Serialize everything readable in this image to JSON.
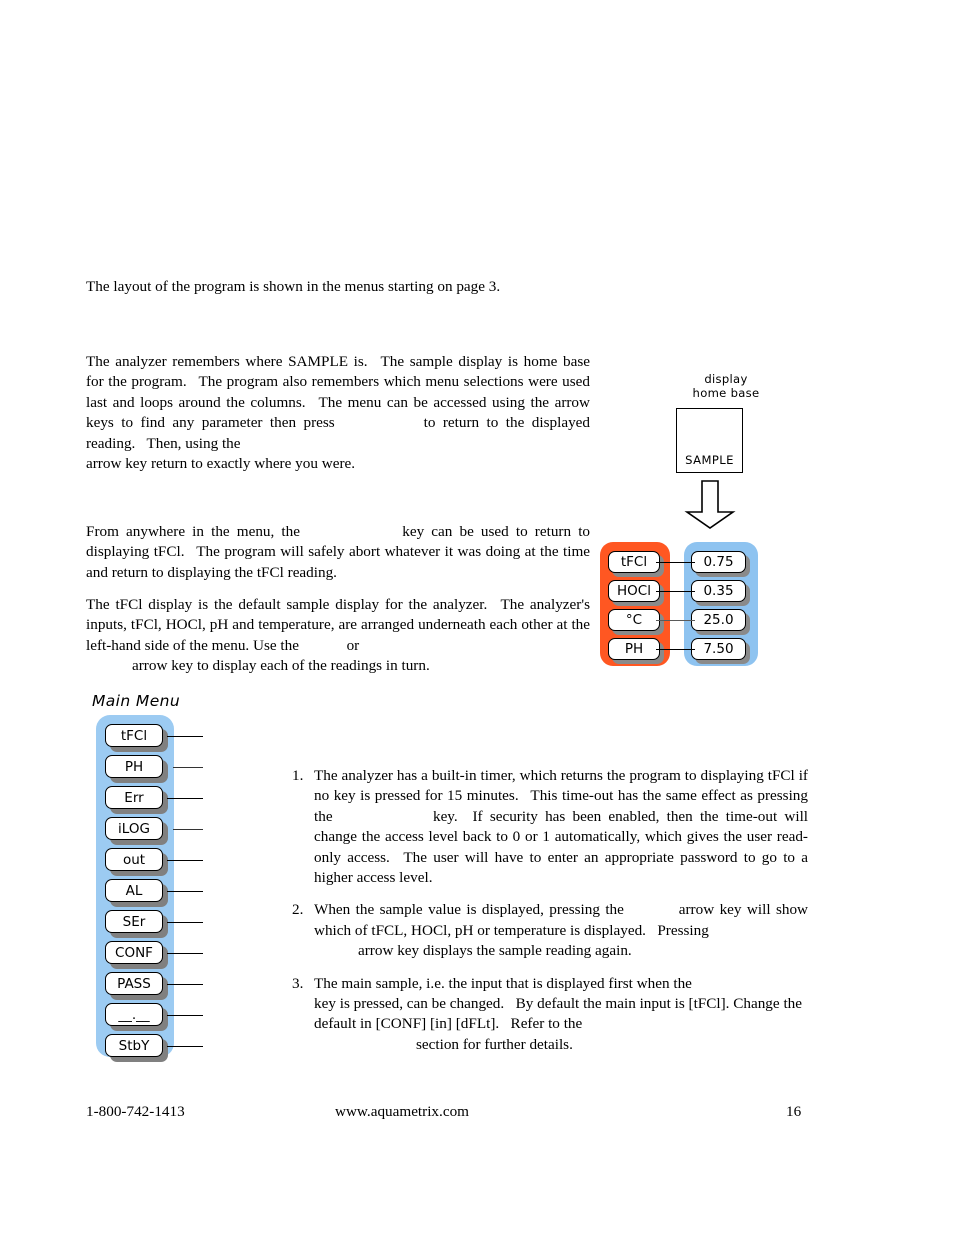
{
  "document": {
    "lead_paragraph": "The layout of the program is shown in the menus starting on page 3.",
    "paragraphs": {
      "p1_a": "The analyzer remembers where SAMPLE is.  The sample display is home base for the program.  The program also remembers which menu selections were used last and loops around the columns.  The menu can be accessed using the arrow keys to find any parameter then press",
      "p1_b": "to return to the displayed reading.  Then, using the",
      "p1_c": "arrow key return to exactly where you were.",
      "p2_a": "From anywhere in the menu, the",
      "p2_b": "key can be used to return to displaying tFCl.  The program will safely abort whatever it was doing at the time and return to displaying the tFCl reading.",
      "p3_a": "The tFCl display is the default sample display for the analyzer.  The analyzer's inputs, tFCl, HOCl, pH and temperature, are arranged underneath each other at the left-hand side of the menu. Use the",
      "p3_b": "or",
      "p3_c": "arrow key to display each of the readings in turn."
    },
    "notes": [
      {
        "number": "1.",
        "text_a": "The analyzer has a built-in timer, which returns the program to displaying tFCl if no key is pressed for 15 minutes.  This time-out has the same effect as pressing the",
        "text_b": "key.  If security has been enabled, then the time-out will change the access level back to 0 or 1 automatically, which gives the user read-only access.  The user will have to enter an appropriate password to go to a higher access level."
      },
      {
        "number": "2.",
        "text_a": "When the sample value is displayed, pressing the",
        "text_b": "arrow key will show which of tFCL, HOCl, pH or temperature is displayed.  Pressing",
        "text_c": "arrow key displays the sample reading again."
      },
      {
        "number": "3.",
        "text_a": "The main sample, i.e. the input that is displayed first when the",
        "text_b": "key is pressed, can be changed.  By default the main input is [tFCl]. Change the default in [CONF] [in] [dFLt].  Refer to the",
        "text_c": "section for further details."
      }
    ]
  },
  "home_base_diagram": {
    "caption_line1": "display",
    "caption_line2": "home base",
    "sample_box_label": "SAMPLE",
    "arrow_icon": "down-block-arrow-icon",
    "colors": {
      "input_column": "#FF5722",
      "value_column": "#8EC3F0",
      "chip_fill": "#FFFFFF",
      "chip_shadow": "#8A8A8A"
    },
    "rows": [
      {
        "input": "tFCl",
        "value": "0.75"
      },
      {
        "input": "HOCl",
        "value": "0.35"
      },
      {
        "input": "°C",
        "value": "25.0"
      },
      {
        "input": "PH",
        "value": "7.50"
      }
    ]
  },
  "main_menu_diagram": {
    "title": "Main Menu",
    "column_color": "#9CCBF2",
    "items": [
      {
        "label": "tFCl"
      },
      {
        "label": "PH"
      },
      {
        "label": "Err"
      },
      {
        "label": "iLOG"
      },
      {
        "label": "out"
      },
      {
        "label": "AL"
      },
      {
        "label": "SEr"
      },
      {
        "label": "CONF"
      },
      {
        "label": "PASS"
      },
      {
        "label": "__.__"
      },
      {
        "label": "StbY"
      }
    ]
  },
  "footer": {
    "phone": "1-800-742-1413",
    "website": "www.aquametrix.com",
    "page_number": "16"
  }
}
